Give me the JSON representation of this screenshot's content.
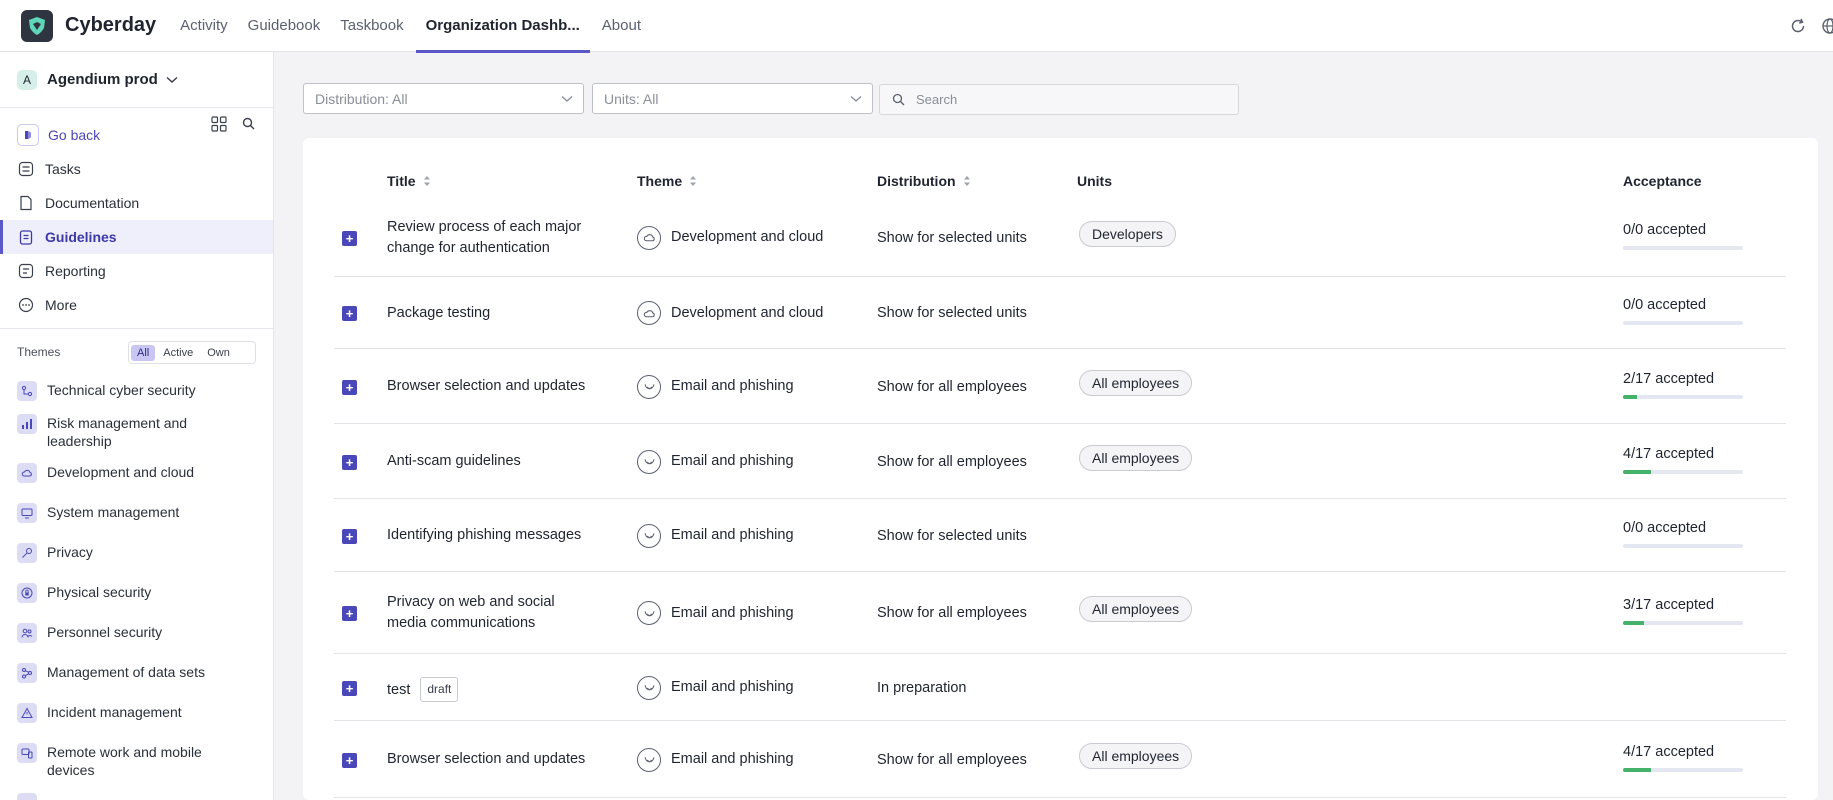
{
  "app": {
    "brand": "Cyberday",
    "nav": [
      {
        "label": "Activity",
        "active": false
      },
      {
        "label": "Guidebook",
        "active": false
      },
      {
        "label": "Taskbook",
        "active": false
      },
      {
        "label": "Organization Dashb...",
        "active": true
      },
      {
        "label": "About",
        "active": false
      }
    ]
  },
  "sidebar": {
    "org": {
      "badge": "A",
      "name": "Agendium prod"
    },
    "menu": [
      {
        "label": "Go back",
        "icon": "go-back-icon"
      },
      {
        "label": "Tasks",
        "icon": "tasks-icon"
      },
      {
        "label": "Documentation",
        "icon": "documentation-icon"
      },
      {
        "label": "Guidelines",
        "icon": "guidelines-icon",
        "active": true
      },
      {
        "label": "Reporting",
        "icon": "reporting-icon"
      },
      {
        "label": "More",
        "icon": "more-icon"
      }
    ],
    "themes_title": "Themes",
    "theme_filter": {
      "options": [
        "All",
        "Active",
        "Own"
      ],
      "selected": "All"
    },
    "themes": [
      {
        "label": "Technical cyber security",
        "icon": "technical-icon"
      },
      {
        "label": "Risk management and leadership",
        "icon": "risk-icon"
      },
      {
        "label": "Development and cloud",
        "icon": "cloud-icon"
      },
      {
        "label": "System management",
        "icon": "monitor-icon"
      },
      {
        "label": "Privacy",
        "icon": "key-icon"
      },
      {
        "label": "Physical security",
        "icon": "lock-icon"
      },
      {
        "label": "Personnel security",
        "icon": "people-icon"
      },
      {
        "label": "Management of data sets",
        "icon": "dataset-icon"
      },
      {
        "label": "Incident management",
        "icon": "warning-icon"
      },
      {
        "label": "Remote work and mobile devices",
        "icon": "devices-icon"
      }
    ]
  },
  "filters": {
    "distribution": "Distribution: All",
    "units": "Units: All",
    "search_placeholder": "Search"
  },
  "table": {
    "columns": {
      "title": "Title",
      "theme": "Theme",
      "distribution": "Distribution",
      "units": "Units",
      "acceptance": "Acceptance"
    },
    "rows": [
      {
        "title": "Review process of each major change for authentication",
        "theme": "Development and cloud",
        "theme_icon": "cloud-icon",
        "distribution": "Show for selected units",
        "units": "Developers",
        "acceptance": "0/0 accepted",
        "progress": 0
      },
      {
        "title": "Package testing",
        "theme": "Development and cloud",
        "theme_icon": "cloud-icon",
        "distribution": "Show for selected units",
        "units": "",
        "acceptance": "0/0 accepted",
        "progress": 0
      },
      {
        "title": "Browser selection and updates",
        "theme": "Email and phishing",
        "theme_icon": "mail-icon",
        "distribution": "Show for all employees",
        "units": "All employees",
        "acceptance": "2/17 accepted",
        "progress": 0.118
      },
      {
        "title": "Anti-scam guidelines",
        "theme": "Email and phishing",
        "theme_icon": "mail-icon",
        "distribution": "Show for all employees",
        "units": "All employees",
        "acceptance": "4/17 accepted",
        "progress": 0.235
      },
      {
        "title": "Identifying phishing messages",
        "theme": "Email and phishing",
        "theme_icon": "mail-icon",
        "distribution": "Show for selected units",
        "units": "",
        "acceptance": "0/0 accepted",
        "progress": 0
      },
      {
        "title": "Privacy on web and social media communications",
        "theme": "Email and phishing",
        "theme_icon": "mail-icon",
        "distribution": "Show for all employees",
        "units": "All employees",
        "acceptance": "3/17 accepted",
        "progress": 0.176
      },
      {
        "title": "test",
        "badge": "draft",
        "theme": "Email and phishing",
        "theme_icon": "mail-icon",
        "distribution": "In preparation",
        "units": "",
        "acceptance": "",
        "progress": null
      },
      {
        "title": "Browser selection and updates",
        "theme": "Email and phishing",
        "theme_icon": "mail-icon",
        "distribution": "Show for all employees",
        "units": "All employees",
        "acceptance": "4/17 accepted",
        "progress": 0.235
      }
    ]
  }
}
